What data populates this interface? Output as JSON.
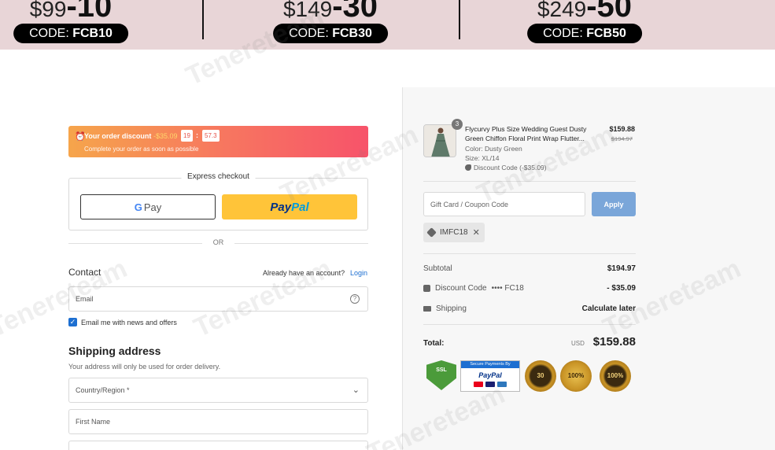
{
  "promo": {
    "items": [
      {
        "price_prefix": "$99",
        "discount": "-10",
        "code_label": "CODE:",
        "code": "FCB10"
      },
      {
        "price_prefix": "$149",
        "discount": "-30",
        "code_label": "CODE:",
        "code": "FCB30"
      },
      {
        "price_prefix": "$249",
        "discount": "-50",
        "code_label": "CODE:",
        "code": "FCB50"
      }
    ]
  },
  "timer": {
    "title": "Your order discount",
    "amount": "-$35.09",
    "minutes": "19",
    "seconds": "57.3",
    "subtitle": "Complete your order as soon as possible"
  },
  "express": {
    "title": "Express checkout",
    "gpay_g": "G",
    "gpay_label": "Pay",
    "paypal_part1": "Pay",
    "paypal_part2": "Pal",
    "or_text": "OR"
  },
  "contact": {
    "title": "Contact",
    "account_text": "Already have an account?",
    "login_label": "Login",
    "email_placeholder": "Email",
    "newsletter_label": "Email me with news and offers",
    "newsletter_checked": true
  },
  "shipping": {
    "title": "Shipping address",
    "subtitle": "Your address will only be used for order delivery.",
    "country_placeholder": "Country/Region *",
    "first_name_placeholder": "First Name"
  },
  "summary": {
    "product": {
      "quantity": "3",
      "name": "Flycurvy Plus Size Wedding Guest Dusty Green Chiffon Floral Print Wrap Flutter...",
      "color": "Color: Dusty Green",
      "size": "Size: XL/14",
      "discount_code": "Discount Code (-$35.09)",
      "price": "$159.88",
      "old_price": "$194.97"
    },
    "gift_placeholder": "Gift Card / Coupon Code",
    "apply_label": "Apply",
    "applied_code": "IMFC18",
    "subtotal_label": "Subtotal",
    "subtotal_value": "$194.97",
    "discount_label": "Discount Code",
    "discount_code_masked": "•••• FC18",
    "discount_value": "- $35.09",
    "shipping_label": "Shipping",
    "shipping_value": "Calculate later",
    "total_label": "Total:",
    "total_currency": "USD",
    "total_value": "$159.88"
  },
  "badges": {
    "ssl": "SSL",
    "secure_header": "Secure Payments By",
    "secure_paypal": "PayPal",
    "seal1": "30",
    "seal2": "100%",
    "seal3": "100%"
  },
  "watermark": "Tenereteam"
}
